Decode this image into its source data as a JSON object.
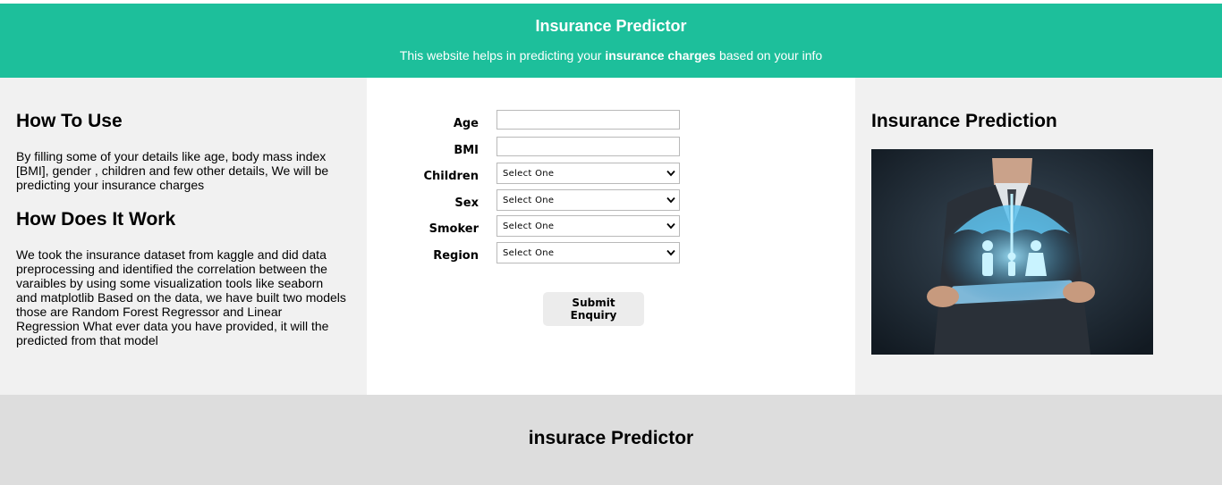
{
  "header": {
    "title": "Insurance Predictor",
    "tagline_before": "This website helps in predicting your ",
    "tagline_bold": "insurance charges",
    "tagline_after": " based on your info"
  },
  "left": {
    "how_to_use_title": "How To Use",
    "how_to_use_text": "By filling some of your details like age, body mass index [BMI], gender , children and few other details, We will be predicting your insurance charges",
    "how_it_works_title": "How Does It Work",
    "how_it_works_text": "We took the insurance dataset from kaggle and did data preprocessing and identified the correlation between the varaibles by using some visualization tools like seaborn and matplotlib Based on the data, we have built two models those are Random Forest Regressor and Linear Regression What ever data you have provided, it will the predicted from that model"
  },
  "form": {
    "age_label": "Age",
    "age_value": "",
    "bmi_label": "BMI",
    "bmi_value": "",
    "children_label": "Children",
    "children_value": "Select One",
    "sex_label": "Sex",
    "sex_value": "Select One",
    "smoker_label": "Smoker",
    "smoker_value": "Select One",
    "region_label": "Region",
    "region_value": "Select One",
    "submit_label": "Submit Enquiry"
  },
  "right": {
    "title": "Insurance Prediction",
    "image_icon": "businessman-umbrella-family-image"
  },
  "footer": {
    "title": "insurace Predictor"
  },
  "colors": {
    "header_bg": "#1dbf9b",
    "side_bg": "#f1f1f1",
    "footer_bg": "#dddddd"
  }
}
